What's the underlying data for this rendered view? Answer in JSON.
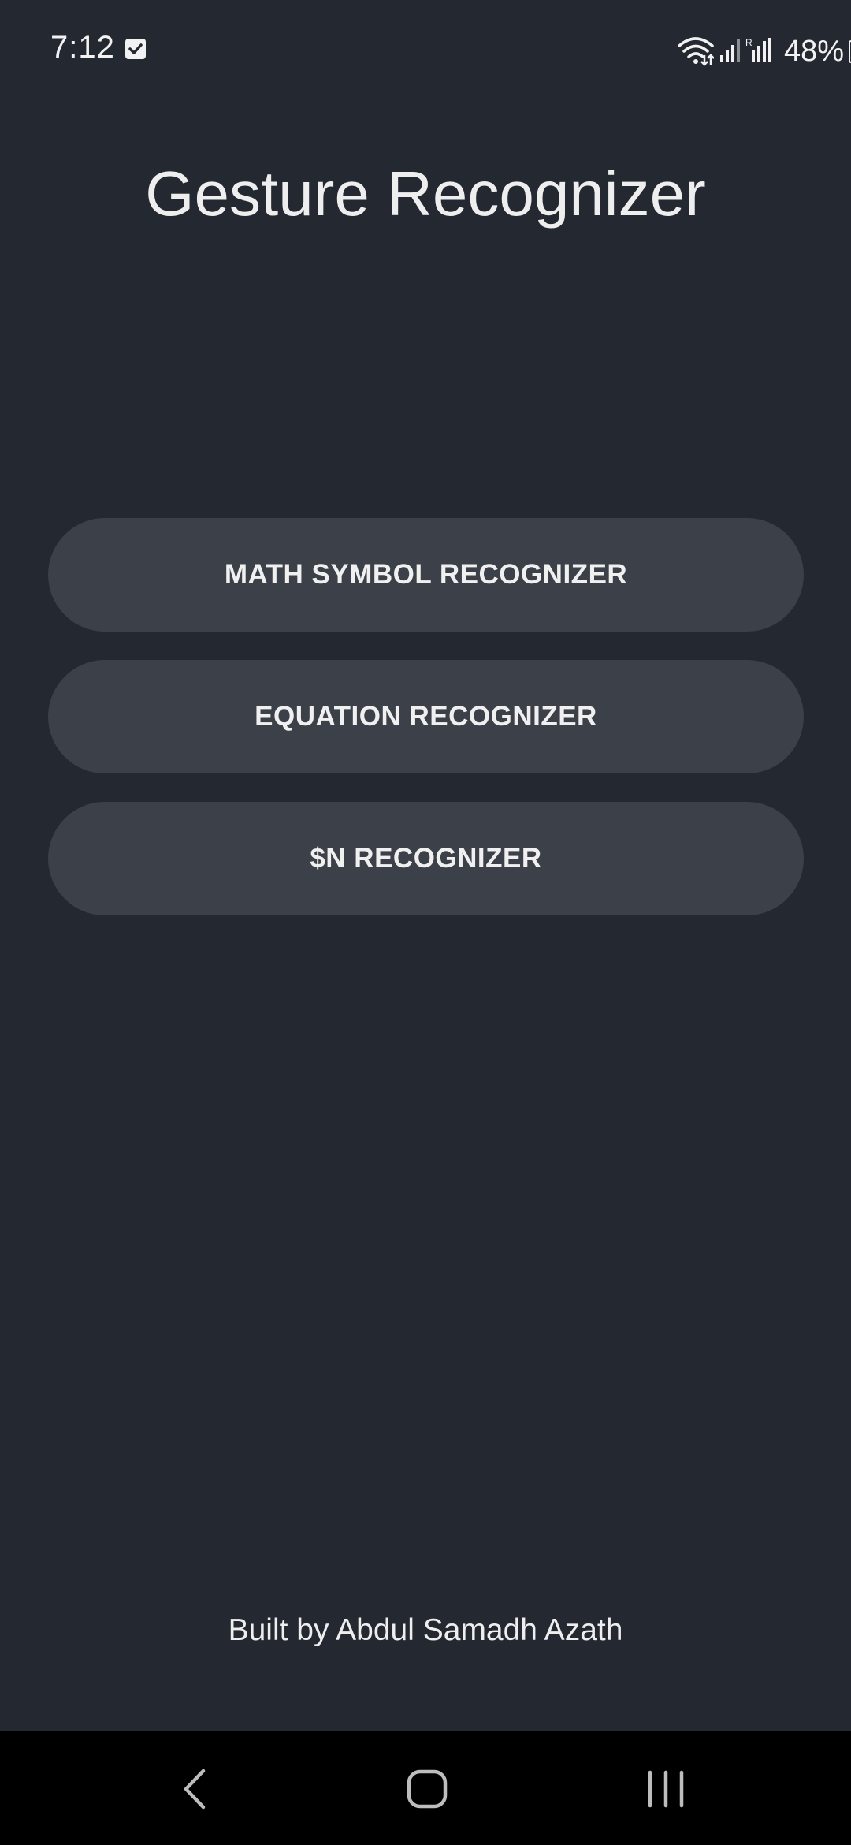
{
  "status_bar": {
    "time": "7:12",
    "notification_icon": "checkbox-icon",
    "wifi_icon": "wifi-icon",
    "signal_icons": [
      "signal-icon",
      "signal-icon"
    ],
    "battery_percent": "48%",
    "battery_icon": "battery-icon"
  },
  "header": {
    "title": "Gesture Recognizer"
  },
  "menu": {
    "buttons": [
      {
        "label": "MATH SYMBOL RECOGNIZER"
      },
      {
        "label": "EQUATION RECOGNIZER"
      },
      {
        "label": "$N RECOGNIZER"
      }
    ]
  },
  "footer": {
    "credit": "Built by Abdul Samadh Azath"
  },
  "nav": {
    "back_icon": "back-icon",
    "home_icon": "home-icon",
    "recents_icon": "recents-icon"
  },
  "colors": {
    "background": "#242831",
    "button_bg": "#3c4048",
    "text": "#eeeeee",
    "nav_bg": "#000000"
  }
}
